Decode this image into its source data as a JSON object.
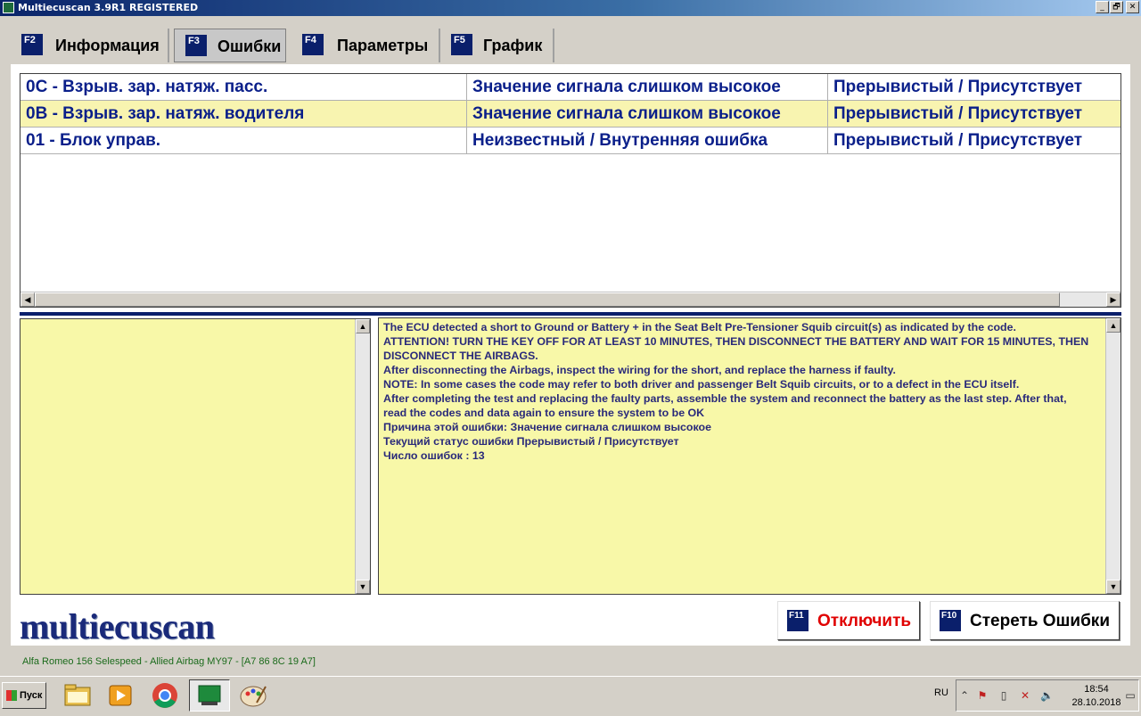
{
  "window": {
    "title": "Multiecuscan 3.9R1 REGISTERED",
    "buttons": [
      "_",
      "🗗",
      "✕"
    ]
  },
  "tabs": [
    {
      "key": "F2",
      "label": "Информация",
      "active": false
    },
    {
      "key": "F3",
      "label": "Ошибки",
      "active": true
    },
    {
      "key": "F4",
      "label": "Параметры",
      "active": false
    },
    {
      "key": "F5",
      "label": "График",
      "active": false
    }
  ],
  "faults": [
    {
      "code": "0C - Взрыв. зар. натяж. пасс.",
      "description": "Значение сигнала слишком высокое",
      "status": "Прерывистый / Присутствует",
      "selected": false
    },
    {
      "code": "0B - Взрыв. зар. натяж.  водителя",
      "description": "Значение сигнала слишком высокое",
      "status": "Прерывистый / Присутствует",
      "selected": true
    },
    {
      "code": "01 - Блок управ.",
      "description": "Неизвестный / Внутренняя ошибка",
      "status": "Прерывистый / Присутствует",
      "selected": false
    }
  ],
  "details": [
    "The ECU detected a short to Ground or Battery + in the Seat Belt Pre-Tensioner Squib circuit(s) as indicated by the code.",
    "ATTENTION! TURN THE KEY OFF FOR AT LEAST 10 MINUTES, THEN DISCONNECT THE BATTERY AND WAIT FOR 15 MINUTES, THEN DISCONNECT THE AIRBAGS.",
    "After disconnecting the Airbags, inspect the wiring for the short, and replace the harness if faulty.",
    "NOTE: In some cases the code may refer to both driver and passenger Belt Squib circuits, or to a defect in the ECU itself.",
    "After completing the test and replacing the faulty parts, assemble the system and reconnect the battery as the last step. After that, read the codes and data again to ensure the system to be OK",
    "Причина этой ошибки: Значение сигнала слишком высокое",
    "Текущий статус ошибки Прерывистый / Присутствует",
    "Число ошибок : 13"
  ],
  "logo": "multiecuscan",
  "actions": {
    "disconnect": {
      "key": "F11",
      "label": "Отключить",
      "color": "#e00000"
    },
    "clear": {
      "key": "F10",
      "label": "Стереть Ошибки",
      "color": "#000000"
    }
  },
  "status_line": "Alfa Romeo 156 Selespeed - Allied Airbag MY97 - [A7 86 8C 19 A7]",
  "taskbar": {
    "start_label": "Пуск",
    "apps": [
      "explorer-icon",
      "media-player-icon",
      "chrome-icon",
      "multiecuscan-icon",
      "paint-icon"
    ],
    "lang": "RU",
    "time": "18:54",
    "date": "28.10.2018"
  },
  "colors": {
    "accent": "#0a1f6b",
    "fault_text": "#0a1f8a",
    "panel_bg": "#f8f8a8",
    "selected_row": "#f8f4b0"
  }
}
